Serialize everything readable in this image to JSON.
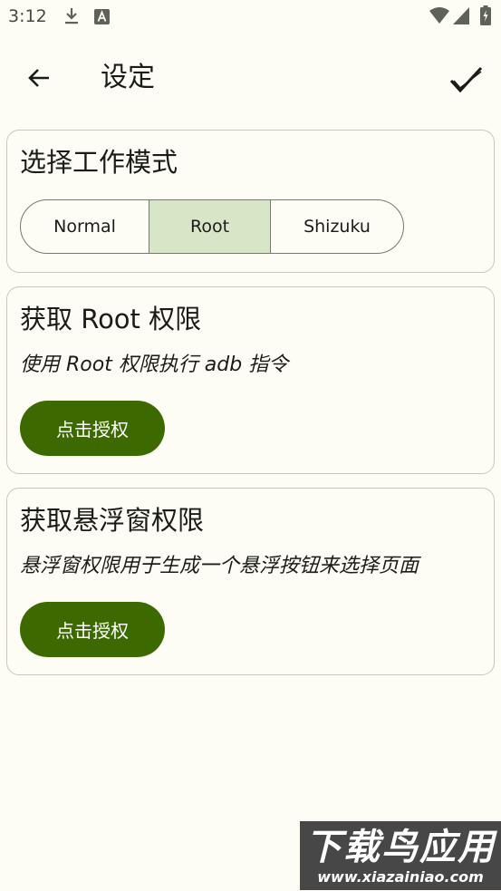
{
  "status_bar": {
    "time": "3:12",
    "icons": [
      "download-icon",
      "a-icon",
      "wifi-icon",
      "signal-icon",
      "battery-icon"
    ]
  },
  "app_bar": {
    "title": "设定",
    "back_icon": "arrow-left-icon",
    "confirm_icon": "check-icon"
  },
  "mode_card": {
    "title": "选择工作模式",
    "options": [
      "Normal",
      "Root",
      "Shizuku"
    ],
    "selected": "Root"
  },
  "root_card": {
    "title": "获取 Root 权限",
    "description": "使用 Root 权限执行 adb 指令",
    "button_label": "点击授权"
  },
  "float_card": {
    "title": "获取悬浮窗权限",
    "description": "悬浮窗权限用于生成一个悬浮按钮来选择页面",
    "button_label": "点击授权"
  },
  "watermark": {
    "main": "下载鸟应用",
    "sub": "www.xiazainiao.com"
  },
  "colors": {
    "background": "#fdfdf5",
    "primary": "#3d6a00",
    "selected_segment": "#d8e6c8",
    "outline": "#c5c8ba"
  }
}
